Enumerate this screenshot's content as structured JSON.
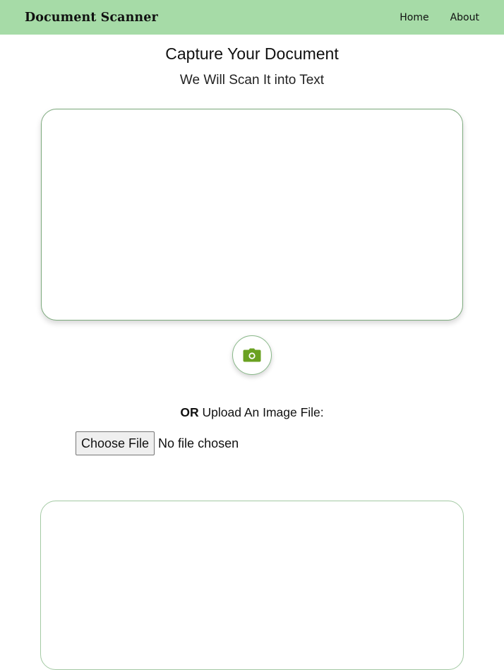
{
  "navbar": {
    "brand": "Document Scanner",
    "links": [
      {
        "label": "Home"
      },
      {
        "label": "About"
      }
    ]
  },
  "main": {
    "heading": "Capture Your Document",
    "subheading": "We Will Scan It into Text",
    "capture_button_icon": "camera-icon",
    "upload": {
      "or_text": "OR",
      "label": "Upload An Image File:",
      "button_label": "Choose File",
      "status": "No file chosen"
    },
    "text_output": ""
  },
  "colors": {
    "navbar_bg": "#a6dba7",
    "accent_green": "#6aa121",
    "border_green": "#7ca97c"
  }
}
